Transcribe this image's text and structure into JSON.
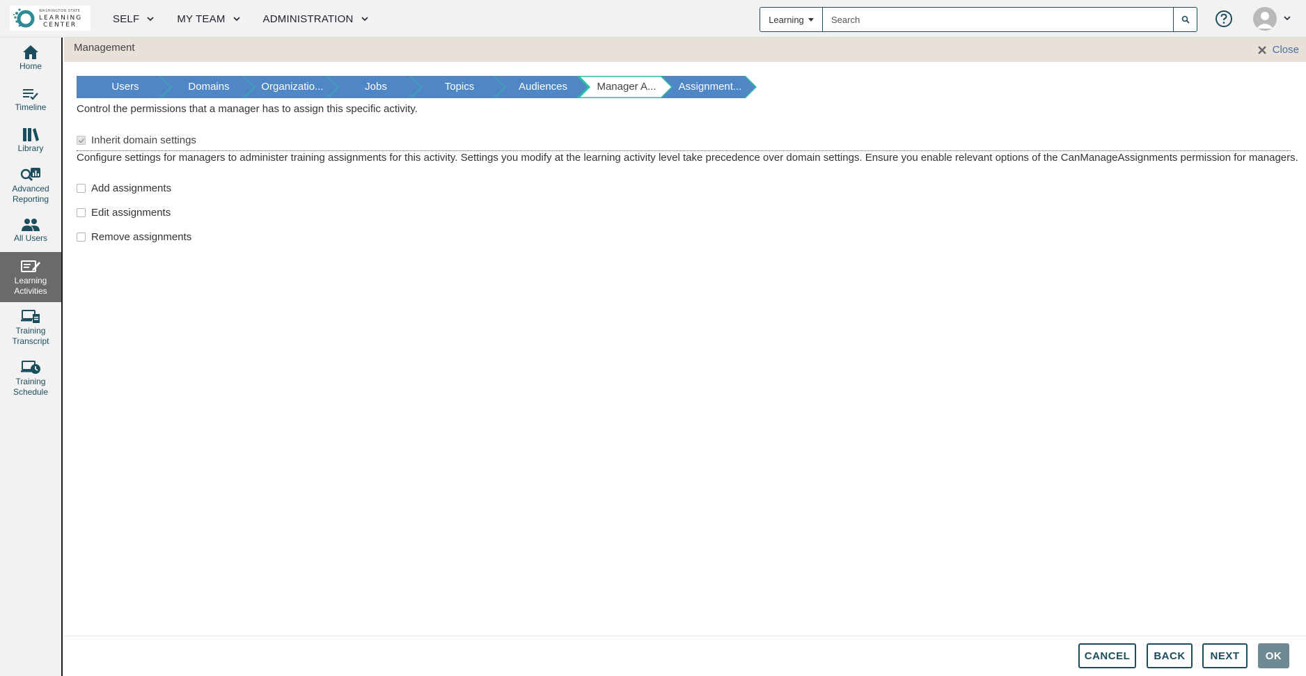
{
  "logo": {
    "line1": "WASHINGTON STATE",
    "line2": "LEARNING",
    "line3": "CENTER"
  },
  "nav": {
    "items": [
      {
        "label": "SELF"
      },
      {
        "label": "MY TEAM"
      },
      {
        "label": "ADMINISTRATION"
      }
    ]
  },
  "search": {
    "scope": "Learning",
    "placeholder": "Search"
  },
  "sidebar": {
    "items": [
      {
        "label": "Home"
      },
      {
        "label": "Timeline"
      },
      {
        "label": "Library"
      },
      {
        "label": "Advanced Reporting"
      },
      {
        "label": "All Users"
      },
      {
        "label": "Learning Activities"
      },
      {
        "label": "Training Transcript"
      },
      {
        "label": "Training Schedule"
      }
    ],
    "active_index": 5
  },
  "header": {
    "title": "Management",
    "close_label": "Close"
  },
  "wizard": {
    "steps": [
      {
        "label": "Users"
      },
      {
        "label": "Domains"
      },
      {
        "label": "Organizatio..."
      },
      {
        "label": "Jobs"
      },
      {
        "label": "Topics"
      },
      {
        "label": "Audiences"
      },
      {
        "label": "Manager A..."
      },
      {
        "label": "Assignment..."
      }
    ],
    "active_index": 6
  },
  "content": {
    "description": "Control the permissions that a manager has to assign this specific activity.",
    "inherit_label": "Inherit domain settings",
    "inherit_checked": true,
    "info": "Configure settings for managers to administer training assignments for this activity. Settings you modify at the learning activity level take precedence over domain settings. Ensure you enable relevant options of the CanManageAssignments permission for managers.",
    "options": [
      {
        "label": "Add assignments",
        "checked": false
      },
      {
        "label": "Edit assignments",
        "checked": false
      },
      {
        "label": "Remove assignments",
        "checked": false
      }
    ]
  },
  "footer": {
    "cancel": "CANCEL",
    "back": "BACK",
    "next": "NEXT",
    "ok": "OK"
  },
  "colors": {
    "step_blue": "#4f86c6",
    "step_active": "#ffffff",
    "step_accent": "#2bbfa4",
    "brand_dark": "#1b4d5c",
    "close_link": "#4a6fa5"
  }
}
